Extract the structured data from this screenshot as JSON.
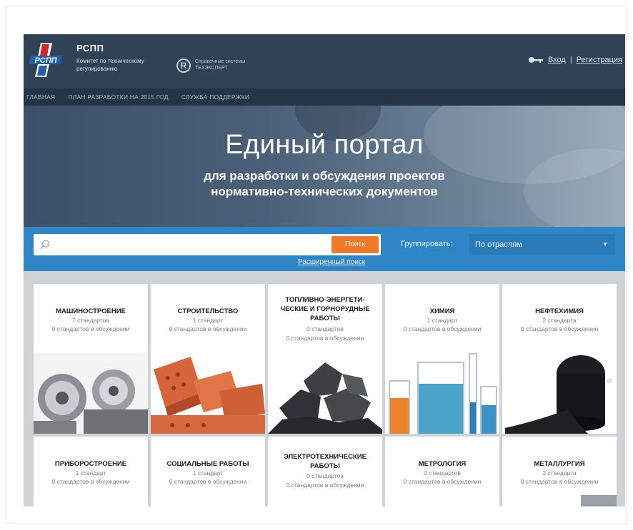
{
  "header": {
    "org_name": "РСПП",
    "org_sub": "Комитет по техническому регулированию",
    "logo_text": "РСПП",
    "ref_system": "Справочные системы ТЕХЭКСПЕРТ",
    "r_mark": "R",
    "login": "Вход",
    "divider": "|",
    "register": "Регистрация"
  },
  "nav": {
    "items": [
      "ГЛАВНАЯ",
      "ПЛАН РАЗРАБОТКИ НА 2015 ГОД",
      "СЛУЖБА ПОДДЕРЖКИ"
    ]
  },
  "hero": {
    "title": "Единый портал",
    "subtitle_line1": "для разработки и обсуждения проектов",
    "subtitle_line2": "нормативно-технических документов"
  },
  "search": {
    "placeholder": "",
    "button": "Поиск",
    "advanced": "Расширенный поиск",
    "group_label": "Группировать:",
    "group_value": "По отраслям"
  },
  "cards_row1": [
    {
      "name": [
        "МАШИНОСТРОЕНИЕ"
      ],
      "count": "7 стандартов",
      "discussion": "0 стандартов в обсуждении",
      "image": "machinery"
    },
    {
      "name": [
        "СТРОИТЕЛЬСТВО"
      ],
      "count": "1 стандарт",
      "discussion": "0 стандартов в обсуждении",
      "image": "bricks"
    },
    {
      "name": [
        "ТОПЛИВНО-ЭНЕРГЕТИ-",
        "ЧЕСКИЕ И ГОРНОРУДНЫЕ",
        "РАБОТЫ"
      ],
      "count": "0 стандартов",
      "discussion": "0 стандартов в обсуждении",
      "image": "coal"
    },
    {
      "name": [
        "ХИМИЯ"
      ],
      "count": "1 стандарт",
      "discussion": "0 стандартов в обсуждении",
      "image": "flasks"
    },
    {
      "name": [
        "НЕФТЕХИМИЯ"
      ],
      "count": "2 стандарта",
      "discussion": "0 стандартов в обсуждении",
      "image": "oil-barrel"
    }
  ],
  "cards_row2": [
    {
      "name": [
        "ПРИБОРОСТРОЕНИЕ"
      ],
      "count": "1 стандарт",
      "discussion": "0 стандартов в обсуждении"
    },
    {
      "name": [
        "СОЦИАЛЬНЫЕ РАБОТЫ"
      ],
      "count": "1 стандарт",
      "discussion": "0 стандартов в обсуждении"
    },
    {
      "name": [
        "ЭЛЕКТРОТЕХНИЧЕСКИЕ",
        "РАБОТЫ"
      ],
      "count": "0 стандартов",
      "discussion": "0 стандартов в обсуждении"
    },
    {
      "name": [
        "МЕТРОЛОГИЯ"
      ],
      "count": "0 стандартов",
      "discussion": "0 стандартов в обсуждении"
    },
    {
      "name": [
        "МЕТАЛЛУРГИЯ"
      ],
      "count": "2 стандарта",
      "discussion": "0 стандартов в обсуждении"
    }
  ],
  "colors": {
    "header_bg": "#2f4256",
    "nav_bg": "#233446",
    "search_band": "#2f86c7",
    "search_button": "#f07a2c"
  }
}
